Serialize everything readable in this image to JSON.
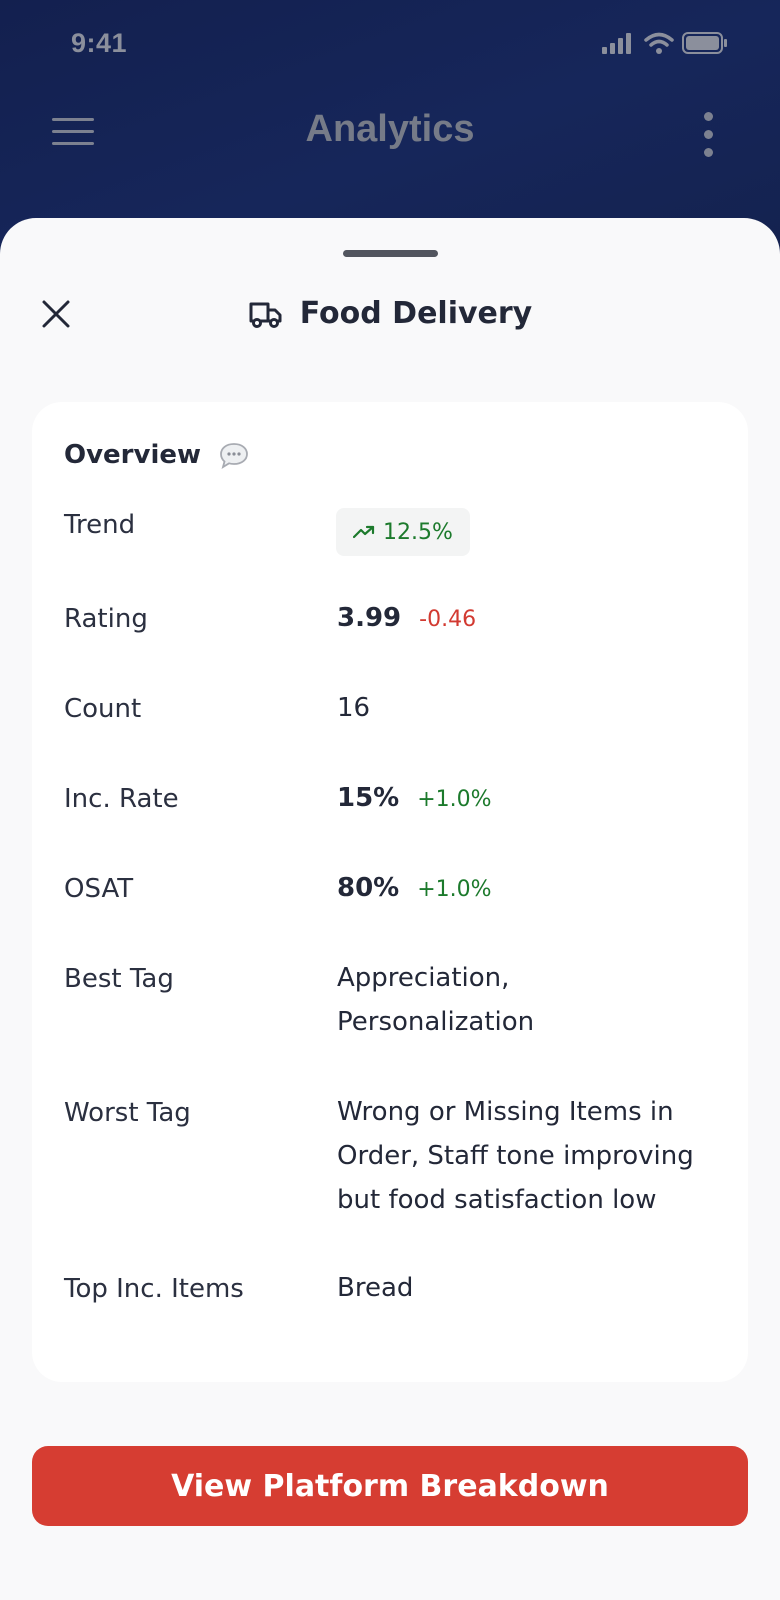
{
  "status_bar": {
    "time": "9:41"
  },
  "app_header": {
    "title": "Analytics"
  },
  "sheet": {
    "title": "Food Delivery",
    "title_icon": "truck-icon"
  },
  "overview": {
    "title": "Overview",
    "info_icon": "chat-bubble-icon",
    "rows": [
      {
        "label": "Trend",
        "value": "12.5%",
        "trend_icon": "trending-up-icon"
      },
      {
        "label": "Rating",
        "value": "3.99",
        "delta": "-0.46"
      },
      {
        "label": "Count",
        "value": "16"
      },
      {
        "label": "Inc. Rate",
        "value": "15%",
        "delta": "+1.0%"
      },
      {
        "label": "OSAT",
        "value": "80%",
        "delta": "+1.0%"
      },
      {
        "label": "Best Tag",
        "value": "Appreciation, Personalization"
      },
      {
        "label": "Worst Tag",
        "value": "Wrong or Missing Items in Order, Staff tone improving but food satisfaction low"
      },
      {
        "label": "Top Inc. Items",
        "value": "Bread"
      }
    ]
  },
  "cta": {
    "label": "View Platform Breakdown"
  },
  "colors": {
    "header_bg": "#14214f",
    "positive": "#1c7a2c",
    "negative": "#d23a31",
    "cta_bg": "#d63d32"
  }
}
